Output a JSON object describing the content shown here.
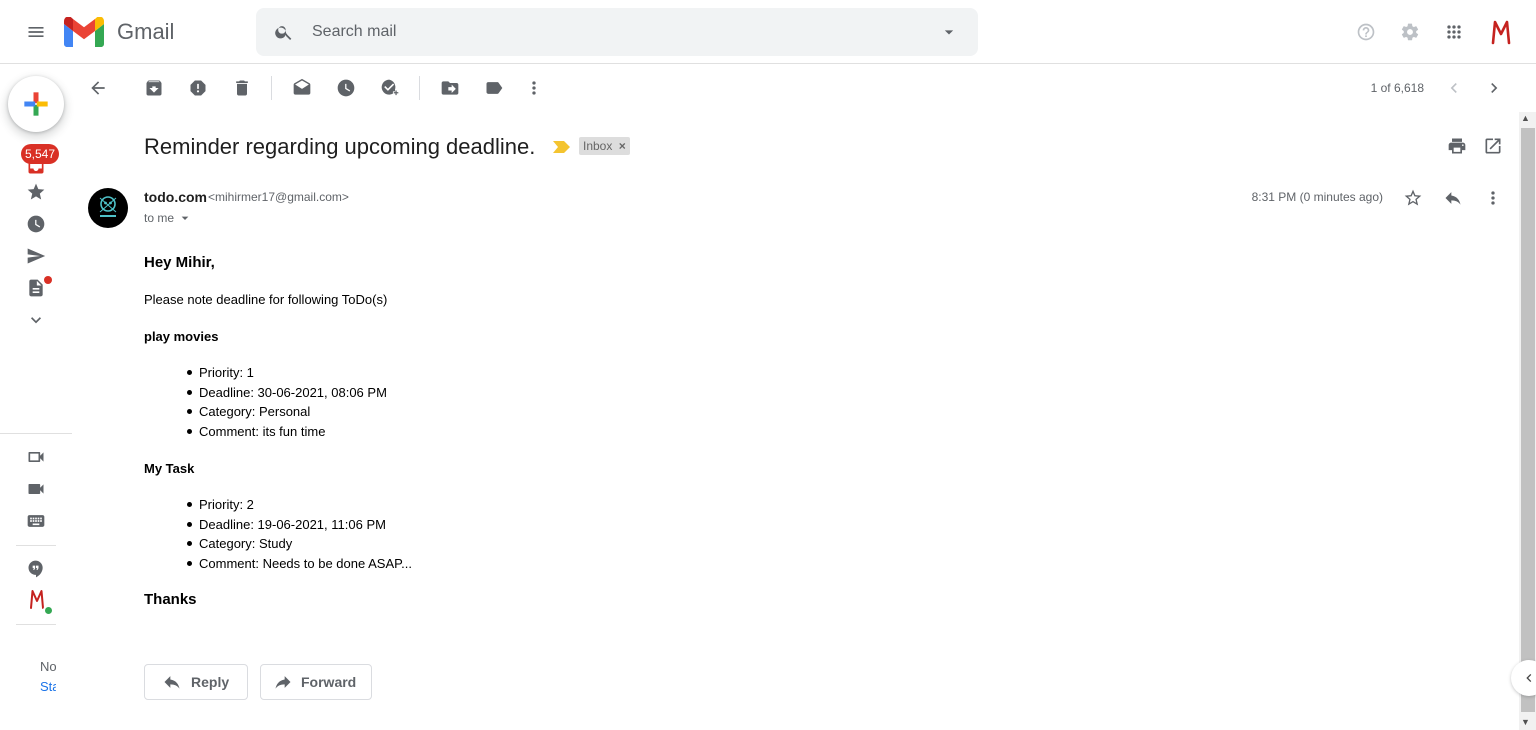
{
  "app": {
    "name": "Gmail"
  },
  "search": {
    "placeholder": "Search mail"
  },
  "left_rail": {
    "inbox_count": "5,547",
    "footer_line1": "No",
    "footer_line2": "Sta"
  },
  "toolbar": {
    "counter": "1 of 6,618"
  },
  "message": {
    "subject": "Reminder regarding upcoming deadline.",
    "label": "Inbox",
    "label_close": "×",
    "sender_name": "todo.com",
    "sender_email": "<mihirmer17@gmail.com>",
    "recipient": "to me",
    "timestamp": "8:31 PM (0 minutes ago)",
    "greeting": "Hey Mihir,",
    "intro": "Please note deadline for following ToDo(s)",
    "todos": [
      {
        "title": "play movies",
        "details": [
          "Priority: 1",
          "Deadline: 30-06-2021, 08:06 PM",
          "Category: Personal",
          "Comment: its fun time"
        ]
      },
      {
        "title": "My Task",
        "details": [
          "Priority: 2",
          "Deadline: 19-06-2021, 11:06 PM",
          "Category: Study",
          "Comment: Needs to be done ASAP..."
        ]
      }
    ],
    "signoff": "Thanks"
  },
  "actions": {
    "reply_label": "Reply",
    "forward_label": "Forward"
  },
  "colors": {
    "badge": "#d93025",
    "label_bg": "#dddddd",
    "important_marker": "#f4c430",
    "online": "#34a853",
    "account_red": "#c5221f"
  },
  "icons": [
    "menu-icon",
    "gmail-logo-icon",
    "search-icon",
    "search-options-icon",
    "help-icon",
    "settings-icon",
    "apps-icon",
    "account-avatar",
    "compose-plus-icon",
    "inbox-icon",
    "star-icon",
    "clock-icon",
    "send-icon",
    "drafts-icon",
    "chevron-down-icon",
    "meet-new-icon",
    "meet-video-icon",
    "keyboard-icon",
    "hangouts-icon",
    "back-arrow-icon",
    "archive-icon",
    "report-spam-icon",
    "delete-icon",
    "mark-unread-icon",
    "snooze-icon",
    "add-task-icon",
    "move-to-icon",
    "label-icon",
    "more-vert-icon",
    "chevron-left-icon",
    "chevron-right-icon",
    "print-icon",
    "open-new-window-icon",
    "reply-icon",
    "forward-icon"
  ]
}
